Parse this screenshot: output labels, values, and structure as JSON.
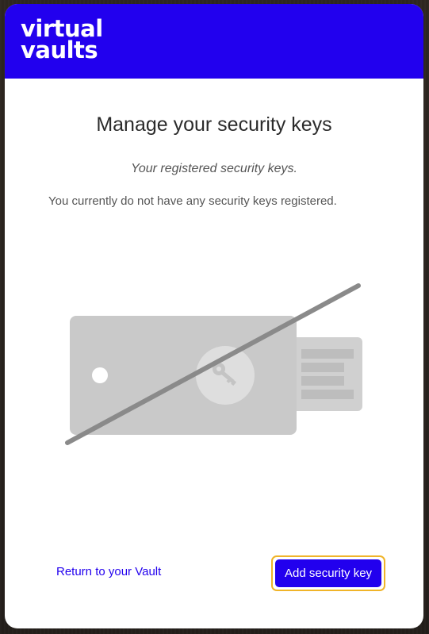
{
  "brand": {
    "line1": "virtual",
    "line2": "vaults",
    "color": "#2200ee"
  },
  "main": {
    "title": "Manage your security keys",
    "subtitle": "Your registered security keys.",
    "empty_message": "You currently do not have any security keys registered."
  },
  "illustration": {
    "description_icon": "security-key-crossed-out-icon"
  },
  "footer": {
    "return_link": "Return to your Vault",
    "add_button": "Add security key",
    "focus_ring_color": "#f0b429"
  }
}
